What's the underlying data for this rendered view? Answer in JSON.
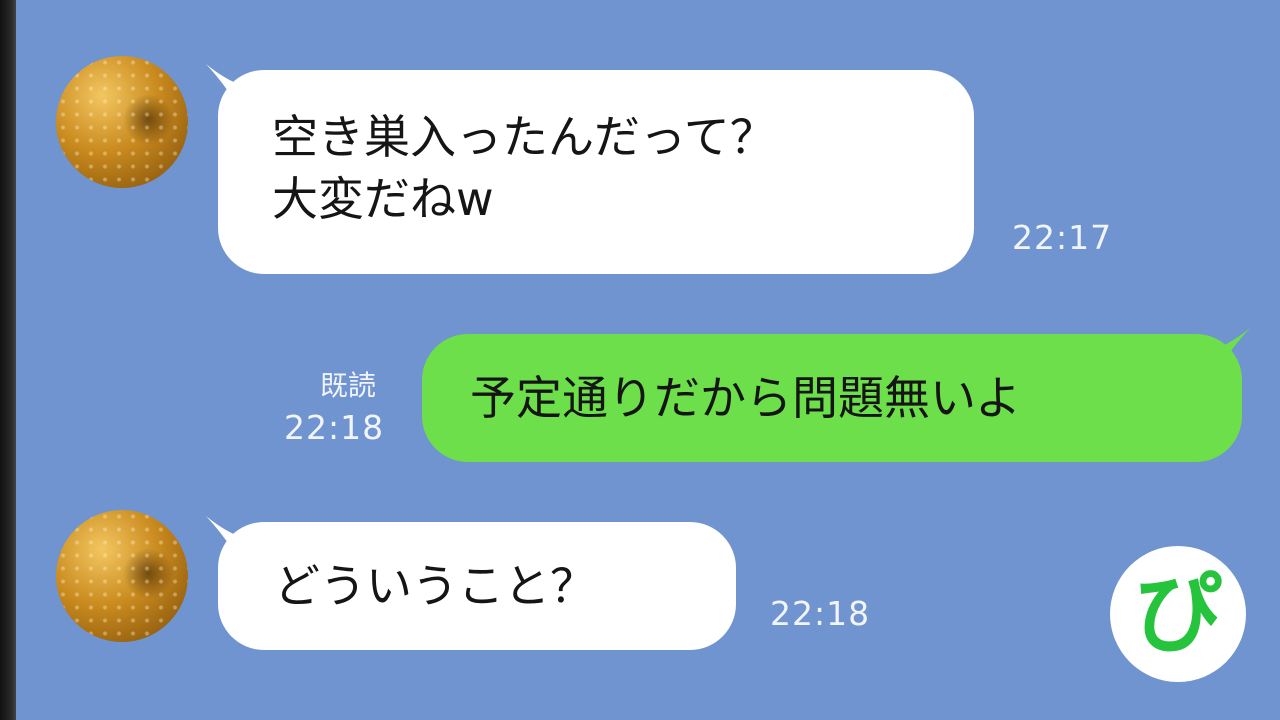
{
  "chat": {
    "messages": [
      {
        "side": "left",
        "lines": [
          "空き巣入ったんだって？",
          "大変だねw"
        ],
        "time": "22:17"
      },
      {
        "side": "right",
        "lines": [
          "予定通りだから問題無いよ"
        ],
        "time": "22:18",
        "read_label": "既読"
      },
      {
        "side": "left",
        "lines": [
          "どういうこと？"
        ],
        "time": "22:18"
      }
    ]
  },
  "logo": {
    "char": "ぴ",
    "color": "#25c43c"
  },
  "colors": {
    "background": "#7094cf",
    "incoming_bubble": "#ffffff",
    "outgoing_bubble": "#6ddf4a"
  }
}
